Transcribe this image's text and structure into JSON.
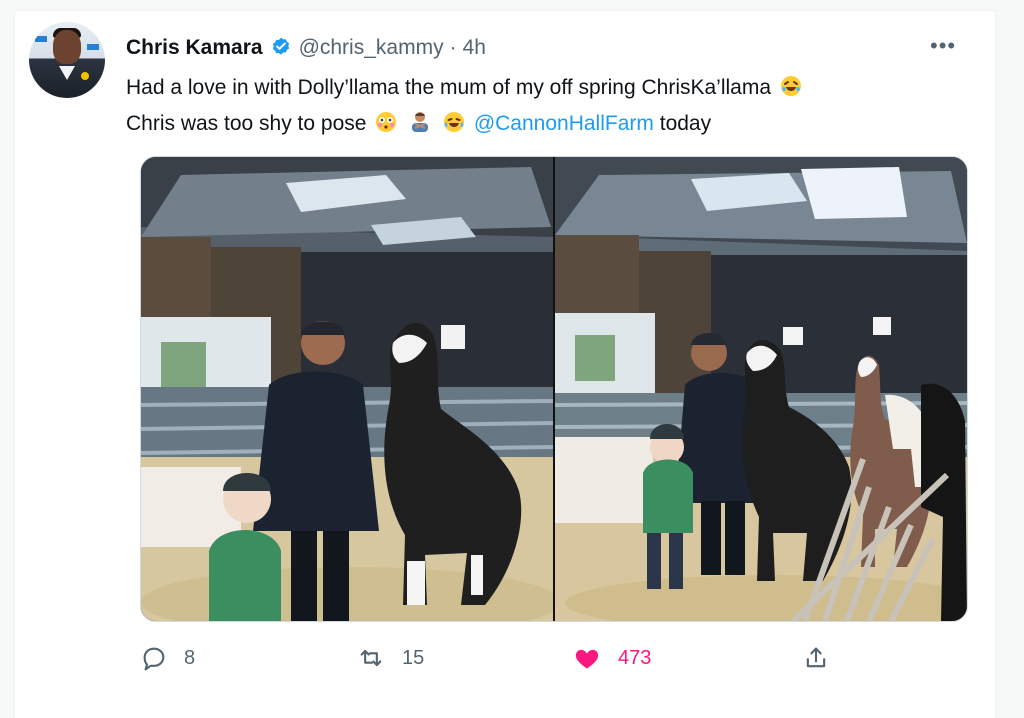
{
  "tweet": {
    "author_name": "Chris Kamara",
    "handle": "@chris_kammy",
    "separator": "·",
    "time": "4h",
    "more_label": "•••",
    "text_line1": "Had a love in with Dolly’llama the mum of my off spring ChrisKa’llama",
    "text_line2_start": "Chris was too shy to pose",
    "mention": "@CannonHallFarm",
    "text_line2_end": "today"
  },
  "actions": {
    "reply_count": "8",
    "retweet_count": "15",
    "like_count": "473"
  },
  "icons": {
    "verified": "verified-badge-icon",
    "more": "more-icon",
    "reply": "reply-icon",
    "retweet": "retweet-icon",
    "like": "heart-icon",
    "share": "share-icon"
  },
  "colors": {
    "accent": "#1d9bf0",
    "like": "#f91880",
    "muted": "#536471",
    "text": "#0f1419"
  }
}
